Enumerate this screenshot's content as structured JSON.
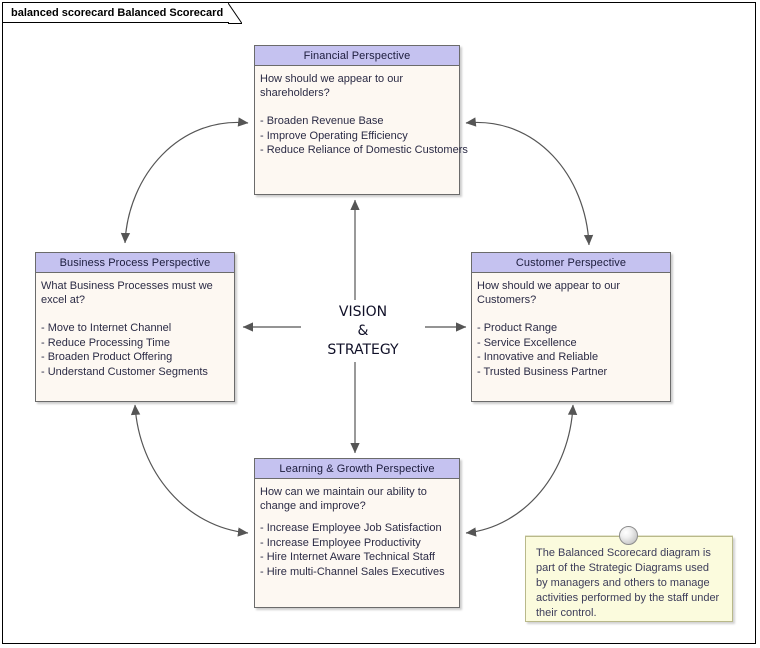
{
  "diagram": {
    "tab_title": "balanced scorecard Balanced Scorecard",
    "center_line1": "VISION",
    "center_line2": "&",
    "center_line3": "STRATEGY",
    "colors": {
      "header_fill": "#c5c2f0",
      "box_fill": "#fdf8f2",
      "note_fill": "#fbfbdd",
      "connector": "#555555",
      "border": "#6b6b6b"
    }
  },
  "boxes": {
    "financial": {
      "title": "Financial Perspective",
      "question": "How should we appear to our shareholders?",
      "items": [
        "- Broaden Revenue Base",
        "- Improve Operating Efficiency",
        "- Reduce Reliance of Domestic Customers"
      ]
    },
    "business_process": {
      "title": "Business Process Perspective",
      "question": "What Business Processes must we excel at?",
      "items": [
        "- Move to Internet Channel",
        "- Reduce Processing Time",
        "- Broaden Product Offering",
        "- Understand Customer Segments"
      ]
    },
    "customer": {
      "title": "Customer Perspective",
      "question": "How should we appear to our Customers?",
      "items": [
        "- Product Range",
        "- Service Excellence",
        "- Innovative and Reliable",
        "- Trusted Business Partner"
      ]
    },
    "learning_growth": {
      "title": "Learning & Growth Perspective",
      "question": "How can we maintain our ability to change and improve?",
      "items": [
        "- Increase Employee Job Satisfaction",
        "- Increase Employee Productivity",
        "- Hire Internet Aware Technical Staff",
        "- Hire multi-Channel Sales Executives"
      ]
    }
  },
  "note": {
    "text": "The Balanced Scorecard diagram is part of the Strategic Diagrams used by managers and others to manage activities performed by the staff under their control."
  }
}
